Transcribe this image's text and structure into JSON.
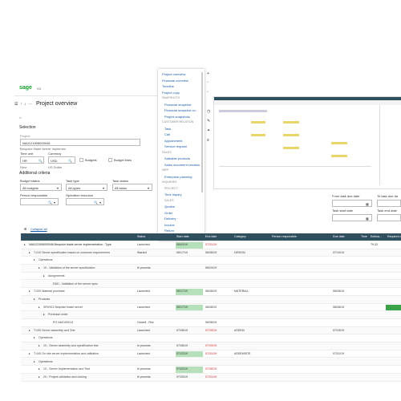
{
  "app": {
    "logo": "sage",
    "version": "X3",
    "page_title": "Project overview",
    "toolbar_icons": [
      "bars-icon",
      "up-icon",
      "down-icon",
      "more-icon"
    ]
  },
  "selection": {
    "heading": "Selection",
    "project_label": "Project",
    "project_value": "NA0121906000046",
    "project_desc": "Bespoke blade server implemen",
    "time_unit_label": "Time unit",
    "time_unit_value": "HR",
    "time_unit_desc": "Hour",
    "currency_label": "Currency",
    "currency_value": "USD",
    "currency_desc": "US Dollar",
    "budgets_label": "Budgets",
    "budget_lines_label": "Budget lines"
  },
  "criteria": {
    "heading": "Additional criteria",
    "budget_status_label": "Budget status",
    "budget_status_value": "All budgets",
    "task_type_label": "Task type",
    "task_type_value": "All types",
    "task_status_label": "Task status",
    "task_status_value": "All tasks",
    "person_label": "Person responsible",
    "operation_label": "Operation resource",
    "from_due_label": "From task due date",
    "to_due_label": "To task due da",
    "start_date_label": "Task start date",
    "end_date_label": "Task end date"
  },
  "nav_menu": {
    "items": [
      {
        "kind": "item",
        "label": "Project overview"
      },
      {
        "kind": "item",
        "label": "Financial overview"
      },
      {
        "kind": "item",
        "label": "Timeline"
      },
      {
        "kind": "item",
        "label": "Project copy"
      },
      {
        "kind": "section",
        "label": "SNAPSHOTS"
      },
      {
        "kind": "item",
        "label": "Financial snapshot"
      },
      {
        "kind": "item",
        "label": "Financial snapshot co..."
      },
      {
        "kind": "item",
        "label": "Project snapshots"
      },
      {
        "kind": "section",
        "label": "CUSTOMER RELATION"
      },
      {
        "kind": "item",
        "label": "Task"
      },
      {
        "kind": "item",
        "label": "Call"
      },
      {
        "kind": "item",
        "label": "Appointment"
      },
      {
        "kind": "item",
        "label": "Service request"
      },
      {
        "kind": "section",
        "label": "SALES"
      },
      {
        "kind": "item",
        "label": "Saleable products"
      },
      {
        "kind": "item",
        "label": "Sales document creation"
      },
      {
        "kind": "section",
        "label": "MRP"
      },
      {
        "kind": "item",
        "label": "Enterprise planning"
      },
      {
        "kind": "section",
        "label": "INQUIRIES"
      },
      {
        "kind": "section",
        "label": "PROJECT"
      },
      {
        "kind": "item",
        "label": "Time inquiry"
      },
      {
        "kind": "section",
        "label": "SALES"
      },
      {
        "kind": "item",
        "label": "Quotes"
      },
      {
        "kind": "item",
        "label": "Order"
      },
      {
        "kind": "item",
        "label": "Delivery"
      },
      {
        "kind": "item",
        "label": "Invoice"
      },
      {
        "kind": "item",
        "label": "Return"
      }
    ]
  },
  "grid": {
    "link_label": "Collapse all",
    "columns": [
      "",
      "Status",
      "Start date",
      "End date",
      "Category",
      "Person responsible",
      "Due date",
      "Time",
      "Estima...",
      "Required qu"
    ],
    "rows": [
      {
        "indent": 0,
        "label": "NA0121906000046 Bespoke blade server implementation : Type",
        "status": "Launched",
        "start": "06/03/19",
        "end": "07/31/19",
        "end_red": true,
        "category": "",
        "due": "",
        "time": "",
        "est": "79.33",
        "bar": ""
      },
      {
        "indent": 1,
        "label": "T-010 Server specification based on customer requirements",
        "status": "Started",
        "start": "06/17/19",
        "end": "06/28/19",
        "end_red": false,
        "category": "DESIGN",
        "due": "07/10/19",
        "time": "",
        "est": "",
        "bar": ""
      },
      {
        "indent": 2,
        "label": "Operations",
        "status": "",
        "start": "",
        "end": "",
        "end_red": false,
        "category": "",
        "due": "",
        "time": "",
        "est": "",
        "bar": ""
      },
      {
        "indent": 3,
        "label": "10 - Validation of the server specification",
        "status": "In process",
        "start": "",
        "end": "06/24/19",
        "end_red": false,
        "category": "",
        "due": "",
        "time": "",
        "est": "",
        "bar": ""
      },
      {
        "indent": 4,
        "label": "Assignments",
        "status": "",
        "start": "",
        "end": "",
        "end_red": false,
        "category": "",
        "due": "",
        "time": "",
        "est": "",
        "bar": ""
      },
      {
        "indent": 5,
        "label": "R&D - Validation of the server spec",
        "status": "",
        "start": "",
        "end": "",
        "end_red": false,
        "category": "",
        "due": "",
        "time": "",
        "est": "",
        "bar": ""
      },
      {
        "indent": 1,
        "label": "T-020 Material purchase",
        "status": "Launched",
        "start": "06/17/19",
        "end": "06/28/19",
        "end_red": false,
        "category": "MATERIAL",
        "due": "06/28/19",
        "time": "",
        "est": "",
        "bar": ""
      },
      {
        "indent": 2,
        "label": "Products",
        "status": "",
        "start": "",
        "end": "",
        "end_red": false,
        "category": "",
        "due": "",
        "time": "",
        "est": "",
        "bar": ""
      },
      {
        "indent": 3,
        "label": "SRV001 Bespoke blade server",
        "status": "Launched",
        "start": "06/17/19",
        "end": "06/28/19",
        "end_red": false,
        "category": "",
        "due": "06/28/19",
        "time": "",
        "est": "",
        "bar": "lgreen"
      },
      {
        "indent": 4,
        "label": "Purchase order",
        "status": "",
        "start": "",
        "end": "",
        "end_red": false,
        "category": "",
        "due": "",
        "time": "",
        "est": "",
        "bar": ""
      },
      {
        "indent": 5,
        "label": "PO NA0100013",
        "status": "Closed - Rec",
        "start": "",
        "end": "06/28/19",
        "end_red": false,
        "category": "",
        "due": "",
        "time": "",
        "est": "",
        "bar": ""
      },
      {
        "indent": 1,
        "label": "T-030 Server assembly and Test",
        "status": "Launched",
        "start": "07/08/19",
        "end": "07/19/19",
        "end_red": true,
        "category": "ASSEM",
        "due": "07/19/19",
        "time": "",
        "est": "",
        "bar": ""
      },
      {
        "indent": 2,
        "label": "Operations",
        "status": "",
        "start": "",
        "end": "",
        "end_red": false,
        "category": "",
        "due": "",
        "time": "",
        "est": "",
        "bar": ""
      },
      {
        "indent": 3,
        "label": "10 - Server assembly and specification test",
        "status": "In process",
        "start": "07/08/19",
        "end": "07/19/19",
        "end_red": true,
        "category": "",
        "due": "",
        "time": "",
        "est": "",
        "bar": ""
      },
      {
        "indent": 1,
        "label": "T-040 On site server implementation and validation",
        "status": "Launched",
        "start": "07/22/19",
        "end": "07/31/19",
        "end_red": true,
        "category": "ASSEMSITE",
        "due": "07/31/19",
        "time": "",
        "est": "",
        "bar": ""
      },
      {
        "indent": 2,
        "label": "Operations",
        "status": "",
        "start": "",
        "end": "",
        "end_red": false,
        "category": "",
        "due": "",
        "time": "",
        "est": "",
        "bar": ""
      },
      {
        "indent": 3,
        "label": "10 - Server Implementation and Test",
        "status": "In process",
        "start": "07/22/19",
        "end": "07/26/19",
        "end_red": true,
        "category": "",
        "due": "",
        "time": "",
        "est": "",
        "bar": ""
      },
      {
        "indent": 3,
        "label": "20 - Project validation and closing",
        "status": "In process",
        "start": "07/29/19",
        "end": "07/31/19",
        "end_red": true,
        "category": "",
        "due": "",
        "time": "",
        "est": "",
        "bar": ""
      }
    ]
  },
  "colors": {
    "header": "#2f4f5f",
    "link": "#1a5aa8",
    "accent_green": "#3aa34a",
    "late_red": "#d02020"
  }
}
